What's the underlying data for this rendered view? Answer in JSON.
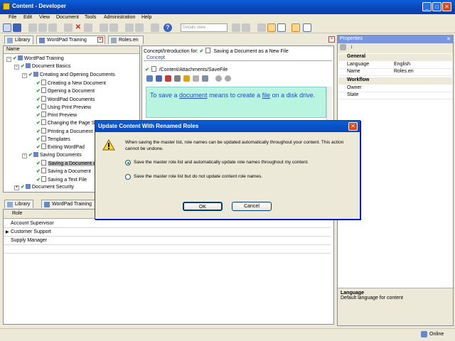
{
  "window": {
    "title": "Content - Developer",
    "min": "_",
    "max": "□",
    "close": "✕"
  },
  "menu": [
    "File",
    "Edit",
    "View",
    "Document",
    "Tools",
    "Administration",
    "Help"
  ],
  "toolbar": {
    "view_select": "Details view"
  },
  "top_tabs": [
    {
      "label": "Library"
    },
    {
      "label": "WordPad Training"
    },
    {
      "label": "Roles.en"
    }
  ],
  "tree": {
    "header": "Name",
    "rows": [
      {
        "label": "WordPad Training",
        "indent": 0,
        "kind": "book",
        "exp": "−"
      },
      {
        "label": "Document Basics",
        "indent": 1,
        "kind": "book",
        "exp": "−"
      },
      {
        "label": "Creating and Opening Documents",
        "indent": 2,
        "kind": "book",
        "exp": "−"
      },
      {
        "label": "Creating a New Document",
        "indent": 3,
        "kind": "doc"
      },
      {
        "label": "Opening a Document",
        "indent": 3,
        "kind": "doc"
      },
      {
        "label": "WordPad Documents",
        "indent": 3,
        "kind": "doc"
      },
      {
        "label": "Using Print Preview",
        "indent": 3,
        "kind": "doc"
      },
      {
        "label": "Print Preview",
        "indent": 3,
        "kind": "doc"
      },
      {
        "label": "Changing the Page S",
        "indent": 3,
        "kind": "doc"
      },
      {
        "label": "Printing a Document",
        "indent": 3,
        "kind": "doc"
      },
      {
        "label": "Templates",
        "indent": 3,
        "kind": "doc"
      },
      {
        "label": "Exiting WordPad",
        "indent": 3,
        "kind": "doc"
      },
      {
        "label": "Saving Documents",
        "indent": 2,
        "kind": "book",
        "exp": "−"
      },
      {
        "label": "Saving a Document a",
        "indent": 3,
        "kind": "doc",
        "selected": true
      },
      {
        "label": "Saving a Document",
        "indent": 3,
        "kind": "doc"
      },
      {
        "label": "Saving a Text File",
        "indent": 3,
        "kind": "doc"
      },
      {
        "label": "Document Security",
        "indent": 1,
        "kind": "book",
        "exp": "+"
      }
    ]
  },
  "concept": {
    "breadcrumb_label": "Concept/Introduction for:",
    "breadcrumb_doc": "Saving a Document as a New File",
    "section": "Concept",
    "path": "/Content/Attachments/SaveFile",
    "text_before": "To save a ",
    "link1": "document",
    "text_mid": " means to create a ",
    "link2": "file",
    "text_after": " on a disk drive."
  },
  "bottom_tabs": [
    {
      "label": "Library"
    },
    {
      "label": "WordPad Training"
    }
  ],
  "roles": {
    "header": "Role",
    "rows": [
      "Account Supervisor",
      "Customer Support",
      "Supply Manager"
    ]
  },
  "properties": {
    "title": "Properties",
    "categories": [
      {
        "name": "General",
        "rows": [
          {
            "name": "Language",
            "value": "English"
          },
          {
            "name": "Name",
            "value": "Roles.en"
          }
        ]
      },
      {
        "name": "Workflow",
        "rows": [
          {
            "name": "Owner",
            "value": ""
          },
          {
            "name": "State",
            "value": ""
          }
        ]
      }
    ],
    "help_title": "Language",
    "help_text": "Default language for content"
  },
  "dialog": {
    "title": "Update Content With Renamed Roles",
    "message": "When saving the master list, role names can be updated automatically throughout your content.  This action cannot be undone.",
    "option1": "Save the master role list and automatically update role names throughout my content.",
    "option2": "Save the master role list but do not update content role names.",
    "ok": "OK",
    "cancel": "Cancel"
  },
  "status": {
    "online": "Online"
  }
}
